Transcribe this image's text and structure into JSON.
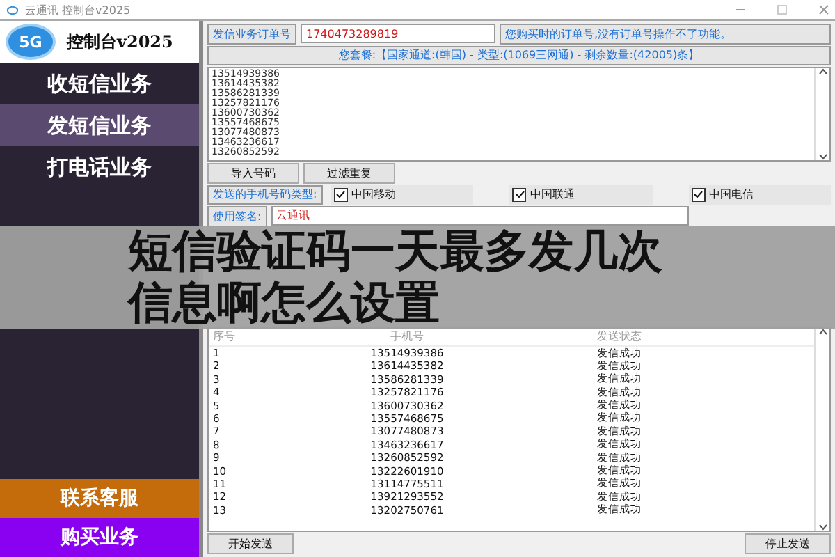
{
  "window": {
    "title": "云通讯 控制台v2025"
  },
  "logo": {
    "badge": "5G",
    "text": "控制台v2025"
  },
  "menu": [
    {
      "label": "收短信业务",
      "selected": false
    },
    {
      "label": "发短信业务",
      "selected": true
    },
    {
      "label": "打电话业务",
      "selected": false
    }
  ],
  "actions": [
    {
      "label": "联系客服",
      "color": "#c46c0c"
    },
    {
      "label": "购买业务",
      "color": "#8a00f0"
    }
  ],
  "order": {
    "label": "发信业务订单号",
    "value": "1740473289819",
    "hint": "您购买时的订单号,没有订单号操作不了功能。"
  },
  "package": "您套餐:【国家通道:(韩国) - 类型:(1069三网通) - 剩余数量:(42005)条】",
  "numbers": [
    "13514939386",
    "13614435382",
    "13586281339",
    "13257821176",
    "13600730362",
    "13557468675",
    "13077480873",
    "13463236617",
    "13260852592"
  ],
  "tools": [
    "导入号码",
    "过滤重复"
  ],
  "carrier_label": "发送的手机号码类型:",
  "carriers": [
    {
      "label": "中国移动",
      "checked": true
    },
    {
      "label": "中国联通",
      "checked": true
    },
    {
      "label": "中国电信",
      "checked": true
    }
  ],
  "signature": {
    "label": "使用签名:",
    "value": "云通讯"
  },
  "table": {
    "columns": [
      "序号",
      "手机号",
      "发送状态"
    ],
    "rows": [
      [
        "1",
        "13514939386",
        "发信成功"
      ],
      [
        "2",
        "13614435382",
        "发信成功"
      ],
      [
        "3",
        "13586281339",
        "发信成功"
      ],
      [
        "4",
        "13257821176",
        "发信成功"
      ],
      [
        "5",
        "13600730362",
        "发信成功"
      ],
      [
        "6",
        "13557468675",
        "发信成功"
      ],
      [
        "7",
        "13077480873",
        "发信成功"
      ],
      [
        "8",
        "13463236617",
        "发信成功"
      ],
      [
        "9",
        "13260852592",
        "发信成功"
      ],
      [
        "10",
        "13222601910",
        "发信成功"
      ],
      [
        "11",
        "13114775511",
        "发信成功"
      ],
      [
        "12",
        "13921293552",
        "发信成功"
      ],
      [
        "13",
        "13202750761",
        "发信成功"
      ]
    ]
  },
  "bottom_buttons": [
    "开始发送",
    "停止发送"
  ],
  "overlay": {
    "lines": [
      "短信验证码一天最多发几次",
      "信息啊怎么设置"
    ]
  }
}
